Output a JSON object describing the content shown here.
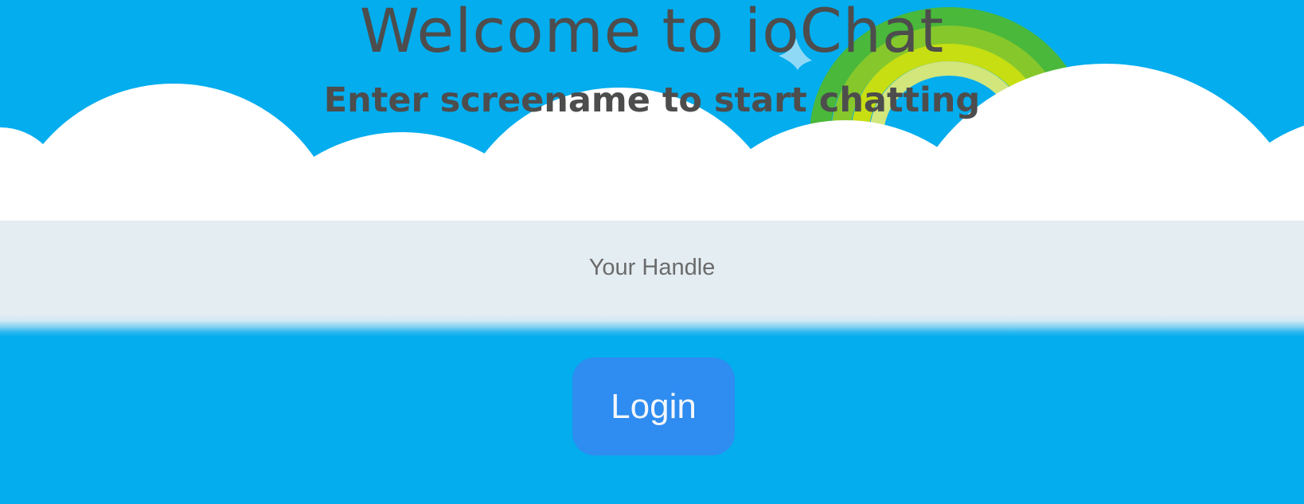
{
  "header": {
    "title": "Welcome to ioChat",
    "subtitle": "Enter screename to start chatting"
  },
  "form": {
    "handle_placeholder": "Your Handle",
    "handle_value": "",
    "login_label": "Login"
  },
  "colors": {
    "sky": "#03adee",
    "cloud": "#ffffff",
    "band": "#e4edf2",
    "button": "#2f8cf0",
    "text": "#4d4d4d"
  },
  "icons": [
    "rainbow-icon",
    "sparkle-icon",
    "cloud-icon"
  ]
}
